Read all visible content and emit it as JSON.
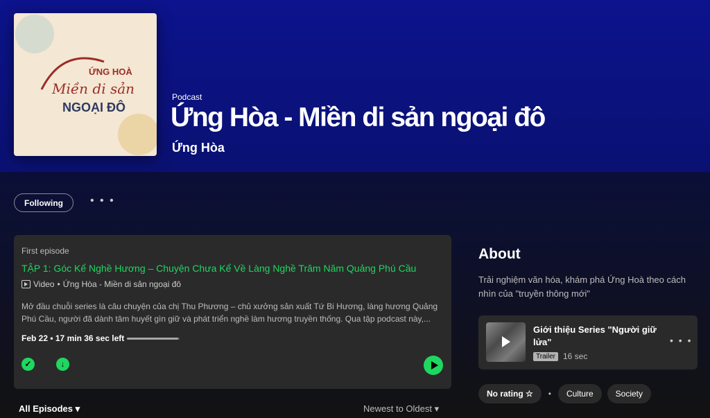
{
  "podcast": {
    "cover_lines": [
      "ỨNG HOÀ",
      "Miền di sản",
      "NGOẠI ĐÔ"
    ],
    "type": "Podcast",
    "title": "Ứng Hòa - Miền di sản ngoại đô",
    "author": "Ứng Hòa"
  },
  "actions": {
    "follow_label": "Following",
    "more_label": "• • •"
  },
  "first_episode": {
    "label": "First episode",
    "title": "TẬP 1: Góc Kể Nghề Hương – Chuyện Chưa Kể Về Làng Nghề Trăm Năm Quảng Phú Cầu",
    "media_type": "Video",
    "show": "Ứng Hòa - Miền di sản ngoại đô",
    "description": "Mở đầu chuỗi series là câu chuyện của chị Thu Phương – chủ xưởng sản xuất Tứ Bi Hương, làng hương Quảng Phú Cầu, người đã dành tâm huyết gìn giữ và phát triển nghề làm hương truyền thống. Qua tập podcast này,...",
    "date_time": "Feb 22 • 17 min 36 sec left",
    "progress_fraction": 0.98
  },
  "episodes_filter": {
    "label": "All Episodes",
    "sort_label": "Newest to Oldest"
  },
  "about": {
    "heading": "About",
    "description": "Trải nghiệm văn hóa, khám phá Ứng Hoà theo cách nhìn của \"truyền thông mới\"",
    "trailer": {
      "title": "Giới thiệu Series \"Người giữ lửa\"",
      "badge": "Trailer",
      "duration": "16 sec"
    }
  },
  "tags": {
    "rating": "No rating ☆",
    "separator": "•",
    "items": [
      "Culture",
      "Society"
    ]
  },
  "colors": {
    "accent": "#1ed760",
    "hero": "#0c138d",
    "card": "#2a2a2a"
  }
}
